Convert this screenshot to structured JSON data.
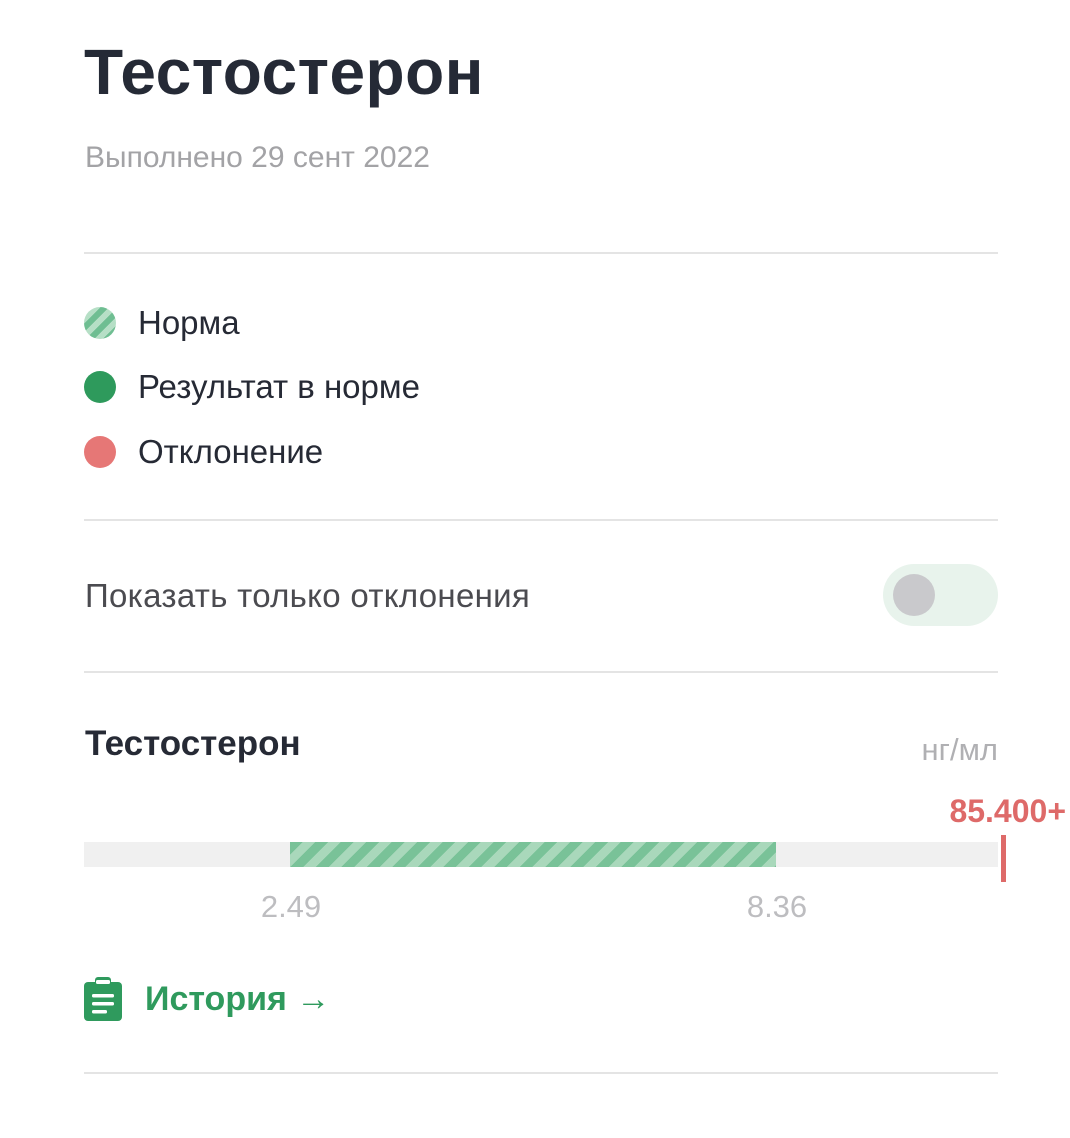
{
  "header": {
    "title": "Тестостерон",
    "subtitle": "Выполнено 29 сент 2022"
  },
  "legend": {
    "items": [
      {
        "label": "Норма",
        "icon": "striped-circle-icon"
      },
      {
        "label": "Результат в норме",
        "icon": "green-circle-icon"
      },
      {
        "label": "Отклонение",
        "icon": "red-circle-icon"
      }
    ]
  },
  "filter": {
    "label": "Показать только отклонения",
    "toggle_on": false
  },
  "test": {
    "name": "Тестостерон",
    "unit": "нг/мл",
    "result": "85.400+",
    "range_low": "2.49",
    "range_high": "8.36"
  },
  "history": {
    "label": "История →",
    "icon": "clipboard-icon"
  },
  "colors": {
    "accent_green": "#2e9a5c",
    "deviation_red": "#de6a69",
    "norm_stripe_light": "#a9d8bb",
    "norm_stripe_dark": "#79c298",
    "title_text": "#252a36",
    "muted_text": "#a3a3a6"
  }
}
